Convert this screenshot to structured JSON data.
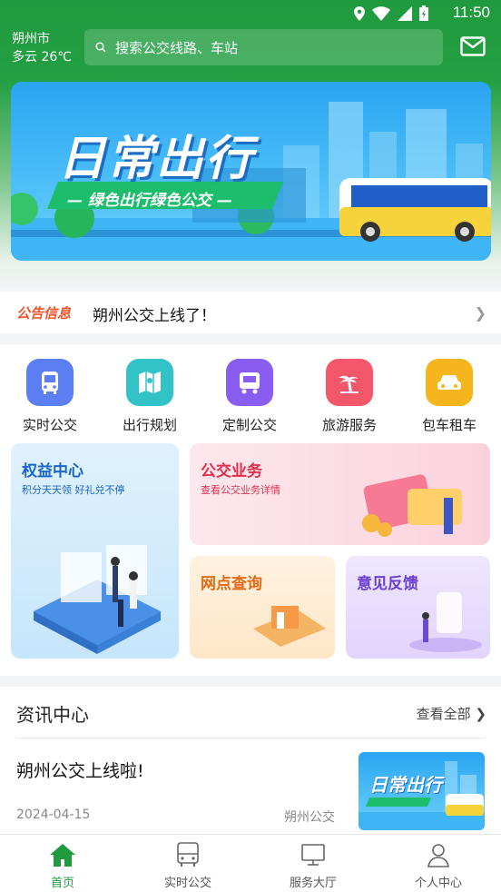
{
  "status_bar": {
    "time": "11:50"
  },
  "header": {
    "city": "朔州市",
    "weather": "多云 26℃",
    "search_placeholder": "搜索公交线路、车站"
  },
  "banner": {
    "title": "日常出行",
    "subtitle": "— 绿色出行绿色公交 —"
  },
  "notice": {
    "tag": "公告信息",
    "message": "朔州公交上线了！"
  },
  "services": [
    {
      "label": "实时公交",
      "icon": "bus-icon",
      "color": "#5b7ef2"
    },
    {
      "label": "出行规划",
      "icon": "map-icon",
      "color": "#32c3c9"
    },
    {
      "label": "定制公交",
      "icon": "custom-bus-icon",
      "color": "#8a5cf0"
    },
    {
      "label": "旅游服务",
      "icon": "island-icon",
      "color": "#f4566a"
    },
    {
      "label": "包车租车",
      "icon": "car-icon",
      "color": "#f6b51c"
    }
  ],
  "cards": {
    "rights": {
      "title": "权益中心",
      "subtitle": "积分天天领 好礼兑不停"
    },
    "business": {
      "title": "公交业务",
      "subtitle": "查看公交业务详情"
    },
    "outlets": {
      "title": "网点查询"
    },
    "feedback": {
      "title": "意见反馈"
    }
  },
  "news": {
    "heading": "资讯中心",
    "view_all": "查看全部",
    "items": [
      {
        "title": "朔州公交上线啦!",
        "date": "2024-04-15",
        "source": "朔州公交",
        "thumb_title": "日常出行"
      }
    ]
  },
  "tabs": [
    {
      "label": "首页",
      "icon": "home-icon",
      "active": true
    },
    {
      "label": "实时公交",
      "icon": "bus-icon",
      "active": false
    },
    {
      "label": "服务大厅",
      "icon": "monitor-icon",
      "active": false
    },
    {
      "label": "个人中心",
      "icon": "user-icon",
      "active": false
    }
  ],
  "colors": {
    "brand_green": "#1f9a3e",
    "notice_red": "#f0542d"
  }
}
